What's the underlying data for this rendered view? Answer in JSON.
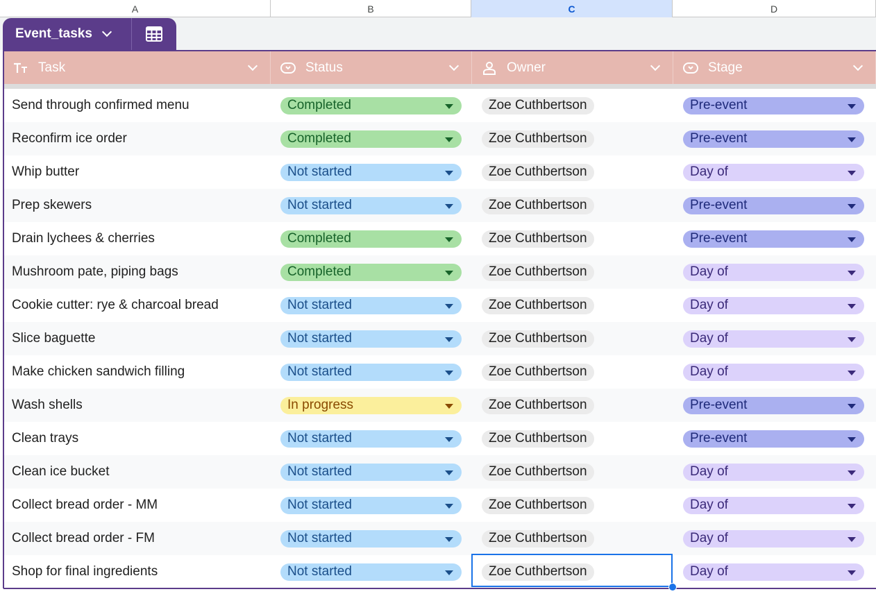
{
  "columns": [
    {
      "letter": "A",
      "active": false
    },
    {
      "letter": "B",
      "active": false
    },
    {
      "letter": "C",
      "active": true
    },
    {
      "letter": "D",
      "active": false
    }
  ],
  "table_tab": {
    "name": "Event_tasks"
  },
  "headers": [
    {
      "label": "Task",
      "icon": "text-type-icon"
    },
    {
      "label": "Status",
      "icon": "dropdown-chip-icon"
    },
    {
      "label": "Owner",
      "icon": "person-icon"
    },
    {
      "label": "Stage",
      "icon": "dropdown-chip-icon"
    }
  ],
  "colors": {
    "accent": "#5b3c8a",
    "header_bg": "#e6b8b0",
    "selection": "#1a73e8"
  },
  "status_styles": {
    "Completed": {
      "bg": "#a8e0a4",
      "fg": "#17632a",
      "tri": "#17632a"
    },
    "Not started": {
      "bg": "#b3dcfb",
      "fg": "#1b4f8a",
      "tri": "#1b4f8a"
    },
    "In progress": {
      "bg": "#fbef9c",
      "fg": "#8a4a00",
      "tri": "#8a4a00"
    }
  },
  "stage_styles": {
    "Pre-event": {
      "bg": "#aab0f0",
      "fg": "#1f2a7a",
      "tri": "#1f2a7a"
    },
    "Day of": {
      "bg": "#dcd2fb",
      "fg": "#3b2a7a",
      "tri": "#3b2a7a"
    }
  },
  "rows": [
    {
      "task": "Send through confirmed menu",
      "status": "Completed",
      "owner": "Zoe Cuthbertson",
      "stage": "Pre-event"
    },
    {
      "task": "Reconfirm ice order",
      "status": "Completed",
      "owner": "Zoe Cuthbertson",
      "stage": "Pre-event"
    },
    {
      "task": "Whip butter",
      "status": "Not started",
      "owner": "Zoe Cuthbertson",
      "stage": "Day of"
    },
    {
      "task": "Prep skewers",
      "status": "Not started",
      "owner": "Zoe Cuthbertson",
      "stage": "Pre-event"
    },
    {
      "task": "Drain lychees & cherries",
      "status": "Completed",
      "owner": "Zoe Cuthbertson",
      "stage": "Pre-event"
    },
    {
      "task": "Mushroom pate, piping bags",
      "status": "Completed",
      "owner": "Zoe Cuthbertson",
      "stage": "Day of"
    },
    {
      "task": "Cookie cutter: rye & charcoal bread",
      "status": "Not started",
      "owner": "Zoe Cuthbertson",
      "stage": "Day of"
    },
    {
      "task": "Slice baguette",
      "status": "Not started",
      "owner": "Zoe Cuthbertson",
      "stage": "Day of"
    },
    {
      "task": "Make chicken sandwich filling",
      "status": "Not started",
      "owner": "Zoe Cuthbertson",
      "stage": "Day of"
    },
    {
      "task": "Wash shells",
      "status": "In progress",
      "owner": "Zoe Cuthbertson",
      "stage": "Pre-event"
    },
    {
      "task": "Clean trays",
      "status": "Not started",
      "owner": "Zoe Cuthbertson",
      "stage": "Pre-event"
    },
    {
      "task": "Clean ice bucket",
      "status": "Not started",
      "owner": "Zoe Cuthbertson",
      "stage": "Day of"
    },
    {
      "task": "Collect bread order - MM",
      "status": "Not started",
      "owner": "Zoe Cuthbertson",
      "stage": "Day of"
    },
    {
      "task": "Collect bread order - FM",
      "status": "Not started",
      "owner": "Zoe Cuthbertson",
      "stage": "Day of"
    },
    {
      "task": "Shop for final ingredients",
      "status": "Not started",
      "owner": "Zoe Cuthbertson",
      "stage": "Day of"
    }
  ],
  "selected_row": 14,
  "selected_column": "owner"
}
